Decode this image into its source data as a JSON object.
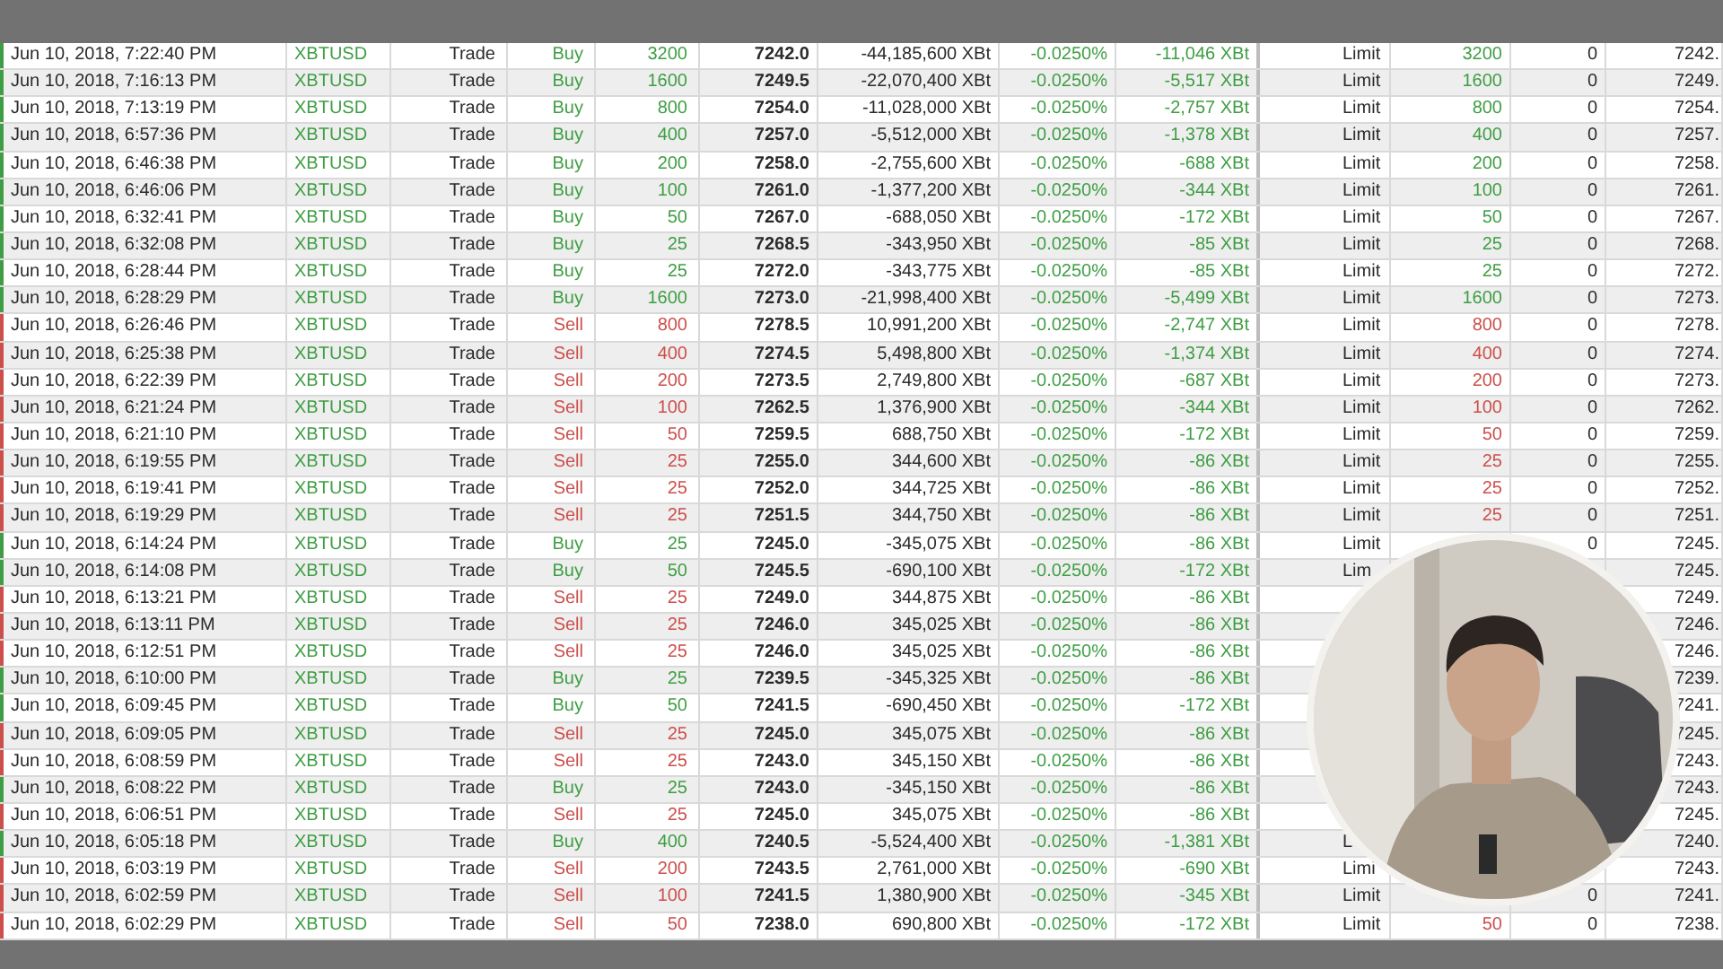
{
  "table": {
    "rows": [
      {
        "time": "Jun 10, 2018, 7:22:40 PM",
        "symbol": "XBTUSD",
        "exec_type": "Trade",
        "side": "Buy",
        "kind": "buy",
        "qty": "3200",
        "price": "7242.0",
        "value": "-44,185,600 XBt",
        "fee_rate": "-0.0250%",
        "fee": "-11,046 XBt",
        "order_type": "Limit",
        "order_qty": "3200",
        "column_12": "0",
        "column_13": "7242."
      },
      {
        "time": "Jun 10, 2018, 7:16:13 PM",
        "symbol": "XBTUSD",
        "exec_type": "Trade",
        "side": "Buy",
        "kind": "buy",
        "qty": "1600",
        "price": "7249.5",
        "value": "-22,070,400 XBt",
        "fee_rate": "-0.0250%",
        "fee": "-5,517 XBt",
        "order_type": "Limit",
        "order_qty": "1600",
        "column_12": "0",
        "column_13": "7249."
      },
      {
        "time": "Jun 10, 2018, 7:13:19 PM",
        "symbol": "XBTUSD",
        "exec_type": "Trade",
        "side": "Buy",
        "kind": "buy",
        "qty": "800",
        "price": "7254.0",
        "value": "-11,028,000 XBt",
        "fee_rate": "-0.0250%",
        "fee": "-2,757 XBt",
        "order_type": "Limit",
        "order_qty": "800",
        "column_12": "0",
        "column_13": "7254."
      },
      {
        "time": "Jun 10, 2018, 6:57:36 PM",
        "symbol": "XBTUSD",
        "exec_type": "Trade",
        "side": "Buy",
        "kind": "buy",
        "qty": "400",
        "price": "7257.0",
        "value": "-5,512,000 XBt",
        "fee_rate": "-0.0250%",
        "fee": "-1,378 XBt",
        "order_type": "Limit",
        "order_qty": "400",
        "column_12": "0",
        "column_13": "7257."
      },
      {
        "time": "Jun 10, 2018, 6:46:38 PM",
        "symbol": "XBTUSD",
        "exec_type": "Trade",
        "side": "Buy",
        "kind": "buy",
        "qty": "200",
        "price": "7258.0",
        "value": "-2,755,600 XBt",
        "fee_rate": "-0.0250%",
        "fee": "-688 XBt",
        "order_type": "Limit",
        "order_qty": "200",
        "column_12": "0",
        "column_13": "7258."
      },
      {
        "time": "Jun 10, 2018, 6:46:06 PM",
        "symbol": "XBTUSD",
        "exec_type": "Trade",
        "side": "Buy",
        "kind": "buy",
        "qty": "100",
        "price": "7261.0",
        "value": "-1,377,200 XBt",
        "fee_rate": "-0.0250%",
        "fee": "-344 XBt",
        "order_type": "Limit",
        "order_qty": "100",
        "column_12": "0",
        "column_13": "7261."
      },
      {
        "time": "Jun 10, 2018, 6:32:41 PM",
        "symbol": "XBTUSD",
        "exec_type": "Trade",
        "side": "Buy",
        "kind": "buy",
        "qty": "50",
        "price": "7267.0",
        "value": "-688,050 XBt",
        "fee_rate": "-0.0250%",
        "fee": "-172 XBt",
        "order_type": "Limit",
        "order_qty": "50",
        "column_12": "0",
        "column_13": "7267."
      },
      {
        "time": "Jun 10, 2018, 6:32:08 PM",
        "symbol": "XBTUSD",
        "exec_type": "Trade",
        "side": "Buy",
        "kind": "buy",
        "qty": "25",
        "price": "7268.5",
        "value": "-343,950 XBt",
        "fee_rate": "-0.0250%",
        "fee": "-85 XBt",
        "order_type": "Limit",
        "order_qty": "25",
        "column_12": "0",
        "column_13": "7268."
      },
      {
        "time": "Jun 10, 2018, 6:28:44 PM",
        "symbol": "XBTUSD",
        "exec_type": "Trade",
        "side": "Buy",
        "kind": "buy",
        "qty": "25",
        "price": "7272.0",
        "value": "-343,775 XBt",
        "fee_rate": "-0.0250%",
        "fee": "-85 XBt",
        "order_type": "Limit",
        "order_qty": "25",
        "column_12": "0",
        "column_13": "7272."
      },
      {
        "time": "Jun 10, 2018, 6:28:29 PM",
        "symbol": "XBTUSD",
        "exec_type": "Trade",
        "side": "Buy",
        "kind": "buy",
        "qty": "1600",
        "price": "7273.0",
        "value": "-21,998,400 XBt",
        "fee_rate": "-0.0250%",
        "fee": "-5,499 XBt",
        "order_type": "Limit",
        "order_qty": "1600",
        "column_12": "0",
        "column_13": "7273."
      },
      {
        "time": "Jun 10, 2018, 6:26:46 PM",
        "symbol": "XBTUSD",
        "exec_type": "Trade",
        "side": "Sell",
        "kind": "sell",
        "qty": "800",
        "price": "7278.5",
        "value": "10,991,200 XBt",
        "fee_rate": "-0.0250%",
        "fee": "-2,747 XBt",
        "order_type": "Limit",
        "order_qty": "800",
        "column_12": "0",
        "column_13": "7278."
      },
      {
        "time": "Jun 10, 2018, 6:25:38 PM",
        "symbol": "XBTUSD",
        "exec_type": "Trade",
        "side": "Sell",
        "kind": "sell",
        "qty": "400",
        "price": "7274.5",
        "value": "5,498,800 XBt",
        "fee_rate": "-0.0250%",
        "fee": "-1,374 XBt",
        "order_type": "Limit",
        "order_qty": "400",
        "column_12": "0",
        "column_13": "7274."
      },
      {
        "time": "Jun 10, 2018, 6:22:39 PM",
        "symbol": "XBTUSD",
        "exec_type": "Trade",
        "side": "Sell",
        "kind": "sell",
        "qty": "200",
        "price": "7273.5",
        "value": "2,749,800 XBt",
        "fee_rate": "-0.0250%",
        "fee": "-687 XBt",
        "order_type": "Limit",
        "order_qty": "200",
        "column_12": "0",
        "column_13": "7273."
      },
      {
        "time": "Jun 10, 2018, 6:21:24 PM",
        "symbol": "XBTUSD",
        "exec_type": "Trade",
        "side": "Sell",
        "kind": "sell",
        "qty": "100",
        "price": "7262.5",
        "value": "1,376,900 XBt",
        "fee_rate": "-0.0250%",
        "fee": "-344 XBt",
        "order_type": "Limit",
        "order_qty": "100",
        "column_12": "0",
        "column_13": "7262."
      },
      {
        "time": "Jun 10, 2018, 6:21:10 PM",
        "symbol": "XBTUSD",
        "exec_type": "Trade",
        "side": "Sell",
        "kind": "sell",
        "qty": "50",
        "price": "7259.5",
        "value": "688,750 XBt",
        "fee_rate": "-0.0250%",
        "fee": "-172 XBt",
        "order_type": "Limit",
        "order_qty": "50",
        "column_12": "0",
        "column_13": "7259."
      },
      {
        "time": "Jun 10, 2018, 6:19:55 PM",
        "symbol": "XBTUSD",
        "exec_type": "Trade",
        "side": "Sell",
        "kind": "sell",
        "qty": "25",
        "price": "7255.0",
        "value": "344,600 XBt",
        "fee_rate": "-0.0250%",
        "fee": "-86 XBt",
        "order_type": "Limit",
        "order_qty": "25",
        "column_12": "0",
        "column_13": "7255."
      },
      {
        "time": "Jun 10, 2018, 6:19:41 PM",
        "symbol": "XBTUSD",
        "exec_type": "Trade",
        "side": "Sell",
        "kind": "sell",
        "qty": "25",
        "price": "7252.0",
        "value": "344,725 XBt",
        "fee_rate": "-0.0250%",
        "fee": "-86 XBt",
        "order_type": "Limit",
        "order_qty": "25",
        "column_12": "0",
        "column_13": "7252."
      },
      {
        "time": "Jun 10, 2018, 6:19:29 PM",
        "symbol": "XBTUSD",
        "exec_type": "Trade",
        "side": "Sell",
        "kind": "sell",
        "qty": "25",
        "price": "7251.5",
        "value": "344,750 XBt",
        "fee_rate": "-0.0250%",
        "fee": "-86 XBt",
        "order_type": "Limit",
        "order_qty": "25",
        "column_12": "0",
        "column_13": "7251."
      },
      {
        "time": "Jun 10, 2018, 6:14:24 PM",
        "symbol": "XBTUSD",
        "exec_type": "Trade",
        "side": "Buy",
        "kind": "buy",
        "qty": "25",
        "price": "7245.0",
        "value": "-345,075 XBt",
        "fee_rate": "-0.0250%",
        "fee": "-86 XBt",
        "order_type": "Limit",
        "column_12": "0",
        "column_13": "7245."
      },
      {
        "time": "Jun 10, 2018, 6:14:08 PM",
        "symbol": "XBTUSD",
        "exec_type": "Trade",
        "side": "Buy",
        "kind": "buy",
        "qty": "50",
        "price": "7245.5",
        "value": "-690,100 XBt",
        "fee_rate": "-0.0250%",
        "fee": "-172 XBt",
        "order_type": "Lim",
        "column_13": "7245."
      },
      {
        "time": "Jun 10, 2018, 6:13:21 PM",
        "symbol": "XBTUSD",
        "exec_type": "Trade",
        "side": "Sell",
        "kind": "sell",
        "qty": "25",
        "price": "7249.0",
        "value": "344,875 XBt",
        "fee_rate": "-0.0250%",
        "fee": "-86 XBt",
        "column_13": "7249."
      },
      {
        "time": "Jun 10, 2018, 6:13:11 PM",
        "symbol": "XBTUSD",
        "exec_type": "Trade",
        "side": "Sell",
        "kind": "sell",
        "qty": "25",
        "price": "7246.0",
        "value": "345,025 XBt",
        "fee_rate": "-0.0250%",
        "fee": "-86 XBt",
        "column_13": "7246."
      },
      {
        "time": "Jun 10, 2018, 6:12:51 PM",
        "symbol": "XBTUSD",
        "exec_type": "Trade",
        "side": "Sell",
        "kind": "sell",
        "qty": "25",
        "price": "7246.0",
        "value": "345,025 XBt",
        "fee_rate": "-0.0250%",
        "fee": "-86 XBt",
        "column_13": "7246."
      },
      {
        "time": "Jun 10, 2018, 6:10:00 PM",
        "symbol": "XBTUSD",
        "exec_type": "Trade",
        "side": "Buy",
        "kind": "buy",
        "qty": "25",
        "price": "7239.5",
        "value": "-345,325 XBt",
        "fee_rate": "-0.0250%",
        "fee": "-86 XBt",
        "column_13": "7239."
      },
      {
        "time": "Jun 10, 2018, 6:09:45 PM",
        "symbol": "XBTUSD",
        "exec_type": "Trade",
        "side": "Buy",
        "kind": "buy",
        "qty": "50",
        "price": "7241.5",
        "value": "-690,450 XBt",
        "fee_rate": "-0.0250%",
        "fee": "-172 XBt",
        "column_13": "7241."
      },
      {
        "time": "Jun 10, 2018, 6:09:05 PM",
        "symbol": "XBTUSD",
        "exec_type": "Trade",
        "side": "Sell",
        "kind": "sell",
        "qty": "25",
        "price": "7245.0",
        "value": "345,075 XBt",
        "fee_rate": "-0.0250%",
        "fee": "-86 XBt",
        "column_13": "7245."
      },
      {
        "time": "Jun 10, 2018, 6:08:59 PM",
        "symbol": "XBTUSD",
        "exec_type": "Trade",
        "side": "Sell",
        "kind": "sell",
        "qty": "25",
        "price": "7243.0",
        "value": "345,150 XBt",
        "fee_rate": "-0.0250%",
        "fee": "-86 XBt",
        "column_13": "7243."
      },
      {
        "time": "Jun 10, 2018, 6:08:22 PM",
        "symbol": "XBTUSD",
        "exec_type": "Trade",
        "side": "Buy",
        "kind": "buy",
        "qty": "25",
        "price": "7243.0",
        "value": "-345,150 XBt",
        "fee_rate": "-0.0250%",
        "fee": "-86 XBt",
        "column_13": "7243."
      },
      {
        "time": "Jun 10, 2018, 6:06:51 PM",
        "symbol": "XBTUSD",
        "exec_type": "Trade",
        "side": "Sell",
        "kind": "sell",
        "qty": "25",
        "price": "7245.0",
        "value": "345,075 XBt",
        "fee_rate": "-0.0250%",
        "fee": "-86 XBt",
        "column_13": "7245."
      },
      {
        "time": "Jun 10, 2018, 6:05:18 PM",
        "symbol": "XBTUSD",
        "exec_type": "Trade",
        "side": "Buy",
        "kind": "buy",
        "qty": "400",
        "price": "7240.5",
        "value": "-5,524,400 XBt",
        "fee_rate": "-0.0250%",
        "fee": "-1,381 XBt",
        "order_type": "L",
        "column_13": "7240."
      },
      {
        "time": "Jun 10, 2018, 6:03:19 PM",
        "symbol": "XBTUSD",
        "exec_type": "Trade",
        "side": "Sell",
        "kind": "sell",
        "qty": "200",
        "price": "7243.5",
        "value": "2,761,000 XBt",
        "fee_rate": "-0.0250%",
        "fee": "-690 XBt",
        "order_type": "Limi",
        "column_13": "7243."
      },
      {
        "time": "Jun 10, 2018, 6:02:59 PM",
        "symbol": "XBTUSD",
        "exec_type": "Trade",
        "side": "Sell",
        "kind": "sell",
        "qty": "100",
        "price": "7241.5",
        "value": "1,380,900 XBt",
        "fee_rate": "-0.0250%",
        "fee": "-345 XBt",
        "order_type": "Limit",
        "column_12": "0",
        "column_13": "7241."
      },
      {
        "time": "Jun 10, 2018, 6:02:29 PM",
        "symbol": "XBTUSD",
        "exec_type": "Trade",
        "side": "Sell",
        "kind": "sell",
        "qty": "50",
        "price": "7238.0",
        "value": "690,800 XBt",
        "fee_rate": "-0.0250%",
        "fee": "-172 XBt",
        "order_type": "Limit",
        "order_qty": "50",
        "column_12": "0",
        "column_13": "7238."
      }
    ]
  }
}
